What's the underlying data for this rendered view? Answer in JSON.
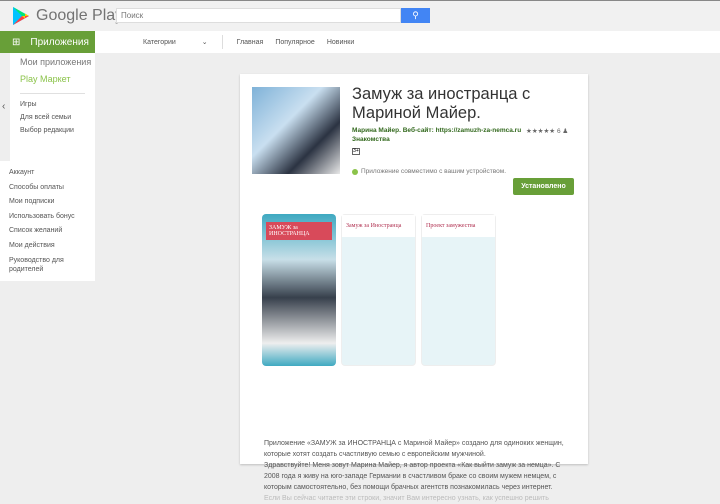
{
  "header": {
    "brand": "Google Play",
    "search_placeholder": "Поиск",
    "search_icon": "search-icon"
  },
  "nav": {
    "apps": "Приложения",
    "categories": "Категории",
    "home": "Главная",
    "popular": "Популярное",
    "new": "Новинки"
  },
  "sidebar": {
    "my_apps": "Мои приложения",
    "play_market": "Play Маркет",
    "items": [
      "Игры",
      "Для всей семьи",
      "Выбор редакции"
    ],
    "account": [
      "Аккаунт",
      "Способы оплаты",
      "Мои подписки",
      "Использовать бонус",
      "Список желаний",
      "Мои действия",
      "Руководство для родителей"
    ]
  },
  "app": {
    "title": "Замуж за иностранца с Мариной Майер.",
    "developer": "Марина Майер. Веб-сайт: https://zamuzh-za-nemca.ru",
    "category": "Знакомства",
    "rating_count": "6",
    "compat": "Приложение совместимо с вашим устройством.",
    "install": "Установлено",
    "screens": [
      "ЗАМУЖ за ИНОСТРАНЦА",
      "Замуж за Иностранца",
      "Проект замужества"
    ],
    "description": [
      "Приложение «ЗАМУЖ за ИНОСТРАНЦА с Мариной Майер» создано для одиноких женщин, которые хотят создать счастливую семью с европейским мужчиной.",
      "Здравствуйте! Меня зовут Марина Майер, я автор проекта «Как выйти замуж за немца». С 2008 года я живу на юго-западе Германии в счастливом браке со своим мужем немцем, с которым самостоятельно, без помощи брачных агентств познакомилась через интернет.",
      "Если Вы сейчас читаете эти строки, значит Вам интересно узнать, как успешно решить"
    ]
  },
  "colors": {
    "green": "#689f38",
    "blue": "#4285f4"
  }
}
